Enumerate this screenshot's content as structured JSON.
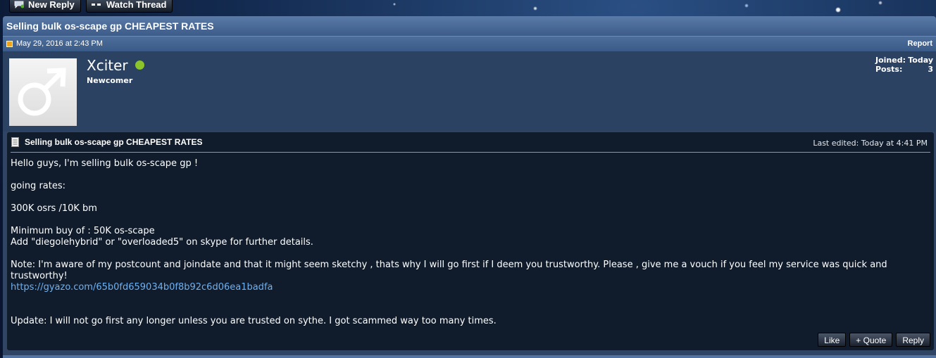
{
  "toolbar": {
    "new_reply": "New Reply",
    "watch_thread": "Watch Thread"
  },
  "thread": {
    "title": "Selling bulk os-scape gp CHEAPEST RATES"
  },
  "post": {
    "date": "May 29, 2016 at 2:43 PM",
    "report": "Report",
    "author": {
      "name": "Xciter",
      "rank": "Newcomer",
      "online_color": "#8bc52a",
      "joined_label": "Joined:",
      "joined_value": "Today",
      "posts_label": "Posts:",
      "posts_value": "3"
    },
    "message": {
      "title": "Selling bulk os-scape gp CHEAPEST RATES",
      "edited": "Last edited: Today at 4:41 PM",
      "lines": [
        "Hello guys, I'm selling bulk os-scape gp !",
        "going rates:",
        "300K osrs /10K bm",
        "Minimum buy of : 50K os-scape",
        "Add \"diegolehybrid\" or \"overloaded5\" on skype for further details.",
        "Note: I'm aware of my postcount and joindate and that it might seem sketchy , thats why I will go first if I deem you trustworthy. Please , give me a vouch if you feel my service was quick and trustworthy!",
        "https://gyazo.com/65b0fd659034b0f8b92c6d06ea1badfa",
        "Update: I will not go first any longer unless you are trusted on sythe. I got scammed way too many times."
      ]
    },
    "actions": {
      "like": "Like",
      "quote": "+ Quote",
      "reply": "Reply"
    }
  }
}
